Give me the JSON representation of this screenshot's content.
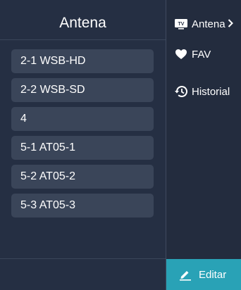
{
  "channel_panel": {
    "title": "Antena",
    "channels": [
      {
        "label": "2-1  WSB-HD"
      },
      {
        "label": "2-2  WSB-SD"
      },
      {
        "label": "4"
      },
      {
        "label": "5-1  AT05-1"
      },
      {
        "label": "5-2  AT05-2"
      },
      {
        "label": "5-3  AT05-3"
      }
    ]
  },
  "side_menu": {
    "items": [
      {
        "label": "Antena",
        "icon": "tv-icon"
      },
      {
        "label": "FAV",
        "icon": "heart-icon"
      },
      {
        "label": "Historial",
        "icon": "history-icon"
      }
    ]
  },
  "edit_button": {
    "label": "Editar",
    "icon": "pencil-icon"
  },
  "colors": {
    "accent": "#29a2b6",
    "panel_bg": "#252f43",
    "item_bg": "#3a4559"
  }
}
